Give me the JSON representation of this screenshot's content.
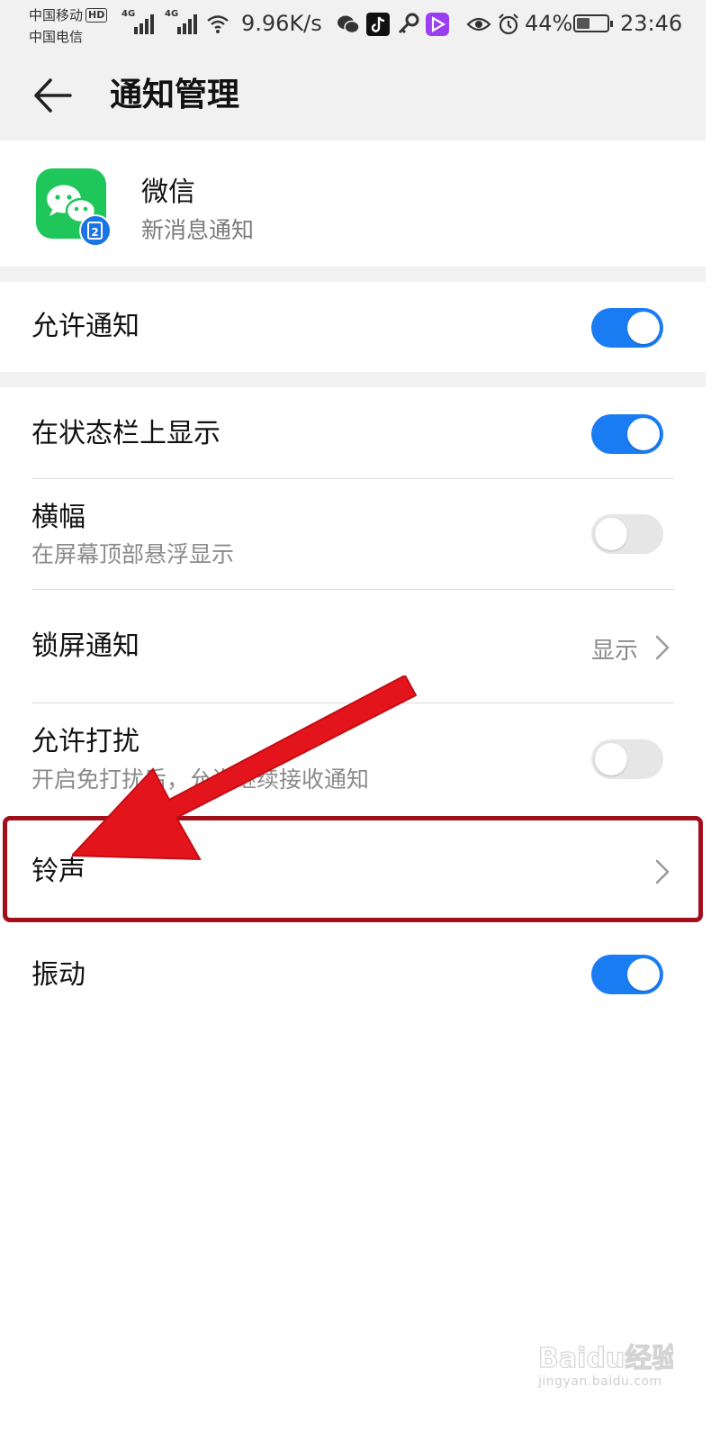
{
  "status_bar": {
    "carrier_1": "中国移动",
    "hd_badge": "HD",
    "carrier_2": "中国电信",
    "signal_1_type": "4G",
    "signal_2_type": "4G",
    "net_speed": "9.96K/s",
    "battery_percent": "44%",
    "battery_level": 0.44,
    "time": "23:46"
  },
  "header": {
    "title": "通知管理",
    "back_icon": "arrow-left-icon"
  },
  "app": {
    "name": "微信",
    "subtitle": "新消息通知",
    "icon": "wechat-icon",
    "badge": "2",
    "icon_color": "#1fc65a"
  },
  "settings": {
    "allow_notifications": {
      "label": "允许通知",
      "enabled": true
    },
    "status_bar": {
      "label": "在状态栏上显示",
      "enabled": true
    },
    "banner": {
      "label": "横幅",
      "subtitle": "在屏幕顶部悬浮显示",
      "enabled": false
    },
    "lock_screen": {
      "label": "锁屏通知",
      "value": "显示"
    },
    "dnd": {
      "label": "允许打扰",
      "subtitle": "开启免打扰后，允许继续接收通知",
      "enabled": false
    },
    "ringtone": {
      "label": "铃声"
    },
    "vibration": {
      "label": "振动",
      "enabled": true
    }
  },
  "colors": {
    "toggle_on": "#1a7cf3",
    "toggle_off": "#e6e6e6",
    "annotation_red": "#e4141c",
    "highlight_border": "#a10f1b"
  },
  "watermark": {
    "text": "jingyan.baidu.com",
    "logo_text": "Baidu经验"
  }
}
